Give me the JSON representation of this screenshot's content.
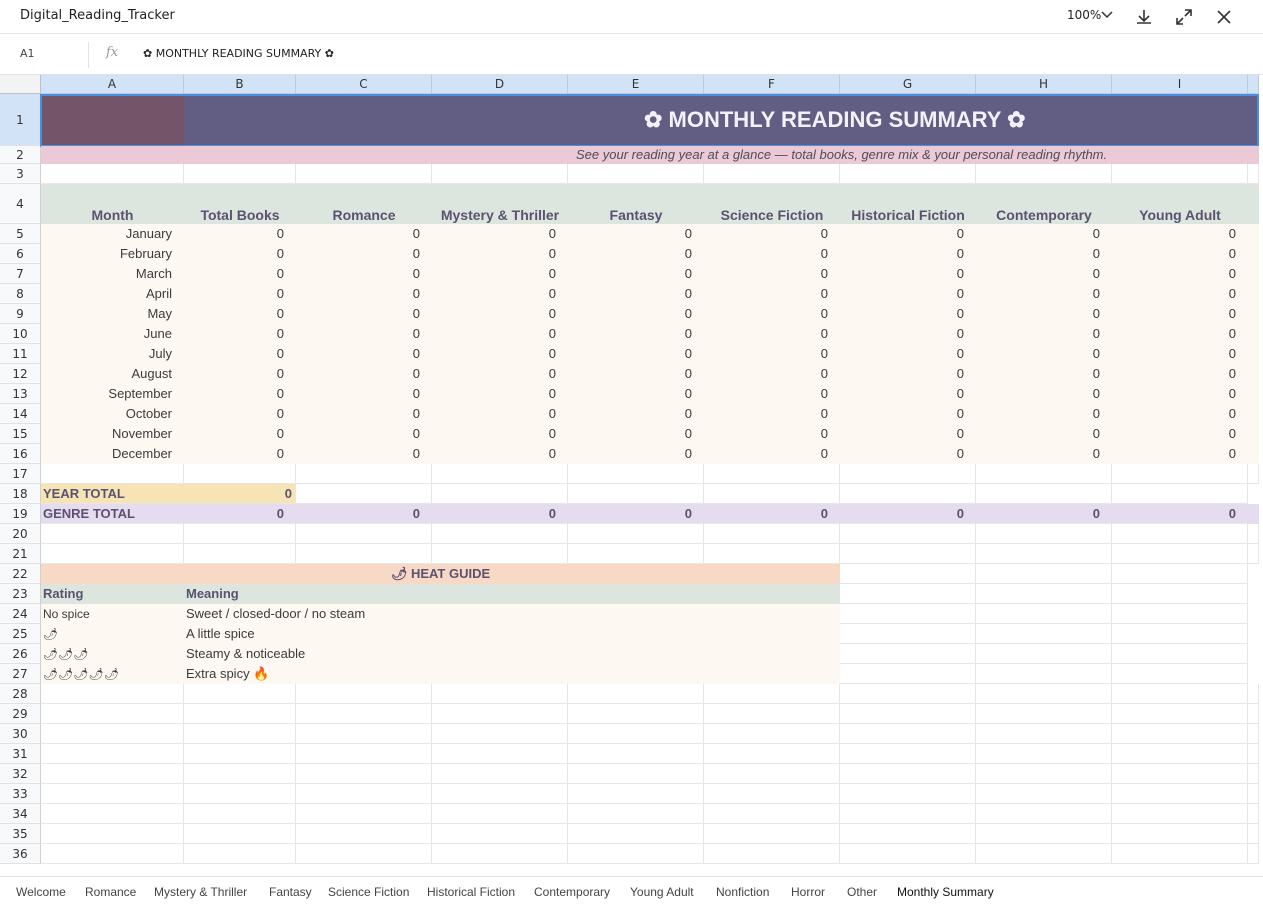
{
  "app": {
    "title": "Digital_Reading_Tracker",
    "zoom": "100%"
  },
  "formula_bar": {
    "cell_ref": "A1",
    "fx": "fx",
    "content": "✿ MONTHLY READING SUMMARY ✿"
  },
  "columns": [
    "A",
    "B",
    "C",
    "D",
    "E",
    "F",
    "G",
    "H",
    "I"
  ],
  "row_numbers": [
    "1",
    "2",
    "3",
    "4",
    "5",
    "6",
    "7",
    "8",
    "9",
    "10",
    "11",
    "12",
    "13",
    "14",
    "15",
    "16",
    "17",
    "18",
    "19",
    "20",
    "21",
    "22",
    "23",
    "24",
    "25",
    "26",
    "27",
    "28",
    "29",
    "30",
    "31",
    "32",
    "33",
    "34",
    "35",
    "36"
  ],
  "banner": {
    "title": "✿ MONTHLY READING SUMMARY ✿",
    "subtitle": "See your reading year at a glance — total books, genre mix & your personal reading rhythm."
  },
  "table": {
    "headers": [
      "Month",
      "Total Books",
      "Romance",
      "Mystery & Thriller",
      "Fantasy",
      "Science Fiction",
      "Historical Fiction",
      "Contemporary",
      "Young Adult"
    ],
    "rows": [
      {
        "month": "January",
        "values": [
          "0",
          "0",
          "0",
          "0",
          "0",
          "0",
          "0",
          "0"
        ]
      },
      {
        "month": "February",
        "values": [
          "0",
          "0",
          "0",
          "0",
          "0",
          "0",
          "0",
          "0"
        ]
      },
      {
        "month": "March",
        "values": [
          "0",
          "0",
          "0",
          "0",
          "0",
          "0",
          "0",
          "0"
        ]
      },
      {
        "month": "April",
        "values": [
          "0",
          "0",
          "0",
          "0",
          "0",
          "0",
          "0",
          "0"
        ]
      },
      {
        "month": "May",
        "values": [
          "0",
          "0",
          "0",
          "0",
          "0",
          "0",
          "0",
          "0"
        ]
      },
      {
        "month": "June",
        "values": [
          "0",
          "0",
          "0",
          "0",
          "0",
          "0",
          "0",
          "0"
        ]
      },
      {
        "month": "July",
        "values": [
          "0",
          "0",
          "0",
          "0",
          "0",
          "0",
          "0",
          "0"
        ]
      },
      {
        "month": "August",
        "values": [
          "0",
          "0",
          "0",
          "0",
          "0",
          "0",
          "0",
          "0"
        ]
      },
      {
        "month": "September",
        "values": [
          "0",
          "0",
          "0",
          "0",
          "0",
          "0",
          "0",
          "0"
        ]
      },
      {
        "month": "October",
        "values": [
          "0",
          "0",
          "0",
          "0",
          "0",
          "0",
          "0",
          "0"
        ]
      },
      {
        "month": "November",
        "values": [
          "0",
          "0",
          "0",
          "0",
          "0",
          "0",
          "0",
          "0"
        ]
      },
      {
        "month": "December",
        "values": [
          "0",
          "0",
          "0",
          "0",
          "0",
          "0",
          "0",
          "0"
        ]
      }
    ]
  },
  "totals": {
    "year_label": "YEAR TOTAL",
    "year_value": "0",
    "genre_label": "GENRE TOTAL",
    "genre_values": [
      "0",
      "0",
      "0",
      "0",
      "0",
      "0",
      "0",
      "0"
    ]
  },
  "heat_guide": {
    "title": "🌶 HEAT GUIDE",
    "headers": [
      "Rating",
      "Meaning"
    ],
    "rows": [
      {
        "rating": "No spice",
        "meaning": "Sweet / closed-door / no steam"
      },
      {
        "rating": "🌶",
        "meaning": "A little spice"
      },
      {
        "rating": "🌶🌶🌶",
        "meaning": "Steamy & noticeable"
      },
      {
        "rating": "🌶🌶🌶🌶🌶",
        "meaning": "Extra spicy 🔥"
      }
    ]
  },
  "sheet_tabs": [
    "Welcome",
    "Romance",
    "Mystery & Thriller",
    "Fantasy",
    "Science Fiction",
    "Historical Fiction",
    "Contemporary",
    "Young Adult",
    "Nonfiction",
    "Horror",
    "Other",
    "Monthly Summary"
  ],
  "active_tab": "Monthly Summary",
  "colors": {
    "banner": "#625d82",
    "banner_a": "#735468",
    "subtitle_bg": "#ecc9d6",
    "header_bg": "#dde6de",
    "data_bg": "#fdf8f1",
    "year_total_bg": "#f6e4b4",
    "genre_total_bg": "#e6dcef",
    "heat_title_bg": "#f8d9c6",
    "heat_header_bg": "#dde6de"
  },
  "icons": {
    "download": "download-icon",
    "expand": "expand-icon",
    "close": "close-icon",
    "zoom_chevron": "chevron-down-icon"
  }
}
